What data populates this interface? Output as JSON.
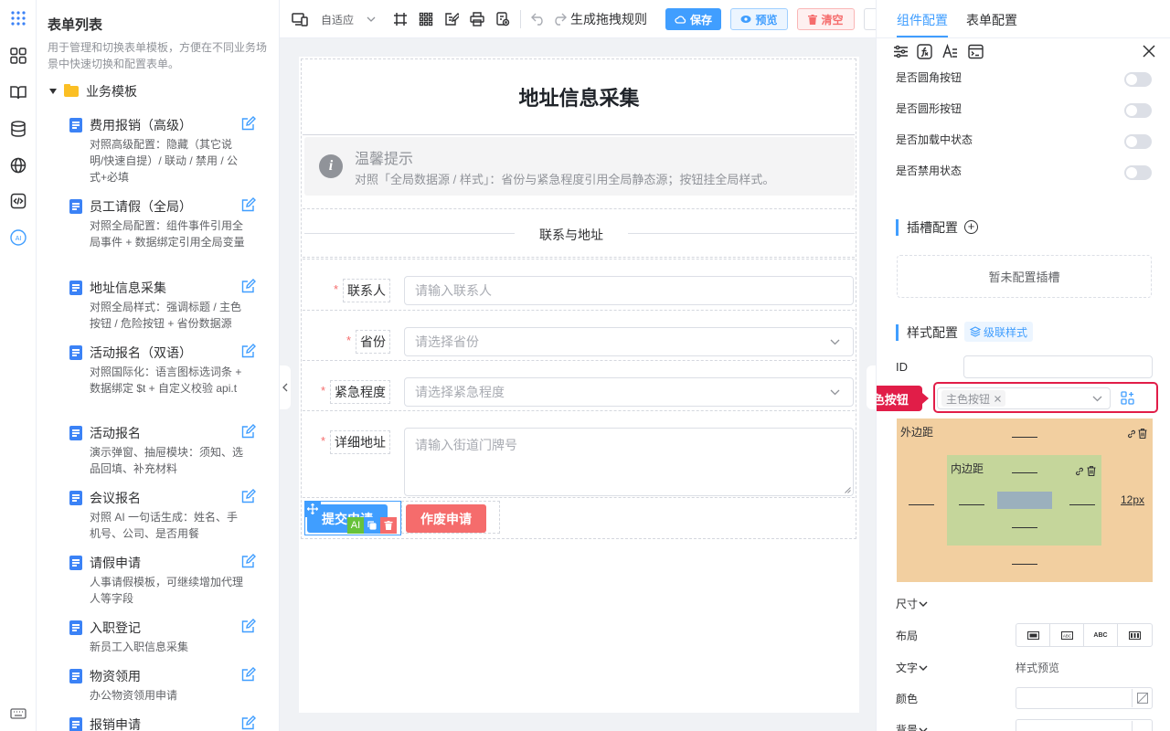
{
  "left_panel": {
    "title": "表单列表",
    "description": "用于管理和切换表单模板，方便在不同业务场景中快速切换和配置表单。",
    "group_label": "业务模板",
    "items": [
      {
        "title": "费用报销（高级）",
        "desc": "对照高级配置：隐藏（其它说明/快速自提）/ 联动 / 禁用 / 公式+必填"
      },
      {
        "title": "员工请假（全局）",
        "desc": "对照全局配置：组件事件引用全局事件 + 数据绑定引用全局变量"
      },
      {
        "title": "地址信息采集",
        "desc": "对照全局样式：强调标题 / 主色按钮 / 危险按钮 + 省份数据源"
      },
      {
        "title": "活动报名（双语）",
        "desc": "对照国际化：语言图标选词条 + 数据绑定 $t + 自定义校验 api.t"
      },
      {
        "title": "活动报名",
        "desc": "演示弹窗、抽屉模块：须知、选品回填、补充材料"
      },
      {
        "title": "会议报名",
        "desc": "对照 AI 一句话生成：姓名、手机号、公司、是否用餐"
      },
      {
        "title": "请假申请",
        "desc": "人事请假模板，可继续增加代理人等字段"
      },
      {
        "title": "入职登记",
        "desc": "新员工入职信息采集"
      },
      {
        "title": "物资领用",
        "desc": "办公物资领用申请"
      },
      {
        "title": "报销申请",
        "desc": ""
      }
    ]
  },
  "toolbar": {
    "adapt_label": "自适应",
    "rule_label": "生成拖拽规则",
    "save_label": "保存",
    "preview_label": "预览",
    "clear_label": "清空"
  },
  "form": {
    "title": "地址信息采集",
    "alert_title": "温馨提示",
    "alert_text": "对照「全局数据源 / 样式」：省份与紧急程度引用全局静态源；按钮挂全局样式。",
    "divider_text": "联系与地址",
    "fields": [
      {
        "label": "联系人",
        "placeholder": "请输入联系人"
      },
      {
        "label": "省份",
        "placeholder": "请选择省份"
      },
      {
        "label": "紧急程度",
        "placeholder": "请选择紧急程度"
      },
      {
        "label": "详细地址",
        "placeholder": "请输入街道门牌号"
      }
    ],
    "submit_label": "提交申请",
    "void_label": "作废申请",
    "ai_badge": "AI"
  },
  "right_panel": {
    "tabs": [
      "组件配置",
      "表单配置"
    ],
    "switches": [
      "是否圆角按钮",
      "是否圆形按钮",
      "是否加载中状态",
      "是否禁用状态"
    ],
    "slot_title": "插槽配置",
    "slot_empty": "暂未配置插槽",
    "style_title": "样式配置",
    "cascade_label": "级联样式",
    "id_label": "ID",
    "class_tag": "主色按钮",
    "callout": "Class选主色按钮",
    "margin_label": "外边距",
    "padding_label": "内边距",
    "margin_right_value": "12px",
    "size_label": "尺寸",
    "layout_label": "布局",
    "layout_options": [
      "ABC",
      "ABC"
    ],
    "text_label": "文字",
    "text_preview": "样式预览",
    "color_label": "颜色",
    "bg_label": "背景"
  },
  "colors": {
    "primary": "#409eff",
    "danger": "#f56c6c",
    "callout": "#e11d48",
    "margin_box": "#f2cfa0",
    "padding_box": "#c5d69b",
    "content_box": "#9bb0bd"
  }
}
